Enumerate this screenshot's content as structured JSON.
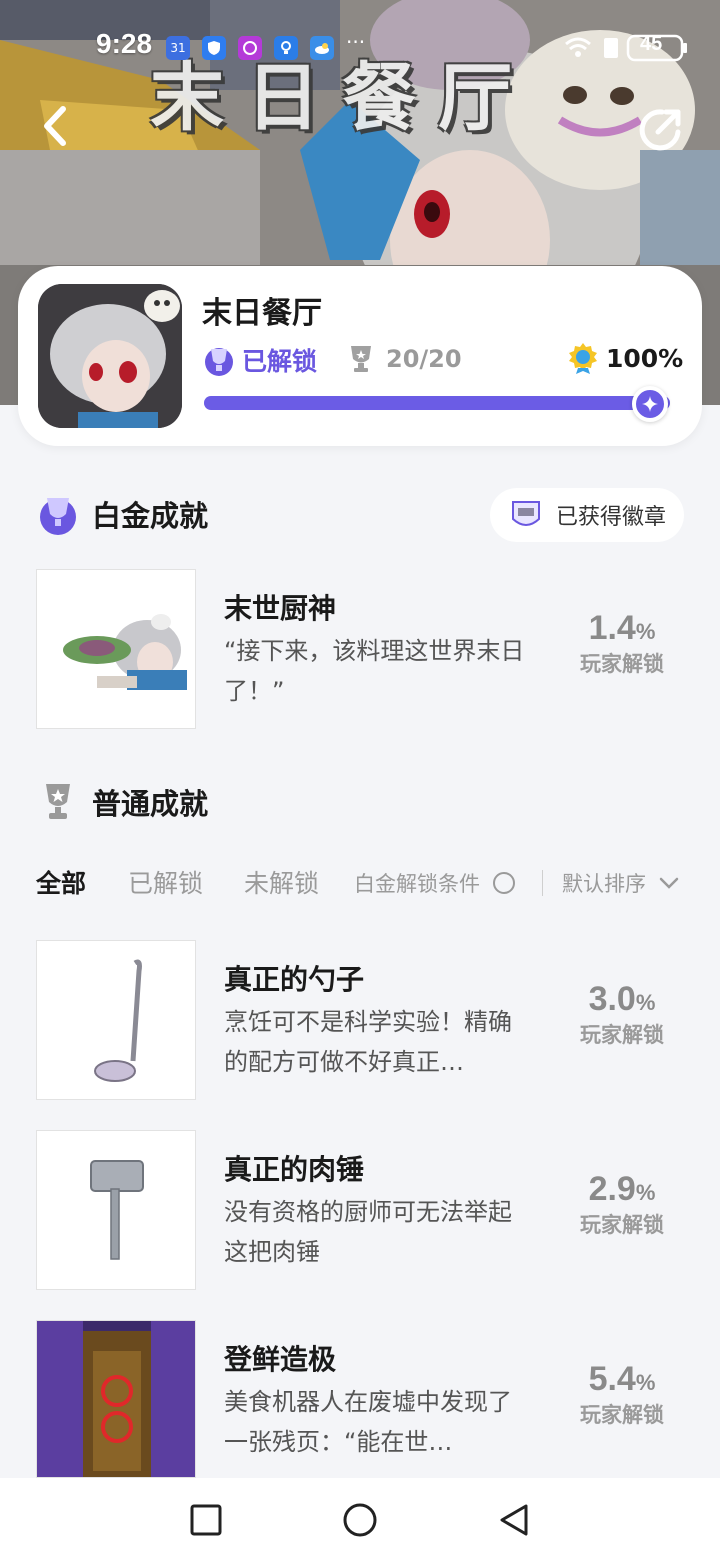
{
  "status_bar": {
    "time": "9:28",
    "calendar_badge": "31",
    "dots": "···",
    "battery": "45"
  },
  "banner": {
    "title": "末日餐厅"
  },
  "game": {
    "name": "末日餐厅",
    "unlock_label": "已解锁",
    "trophy_count": "20/20",
    "completion": "100%",
    "progress_fraction": 1.0
  },
  "platinum_section": {
    "title": "白金成就",
    "badge_chip_label": "已获得徽章",
    "achievement": {
      "name": "末世厨神",
      "desc": "“接下来，该料理这世界末日了！”",
      "pct_num": "1.4",
      "pct_unit": "%",
      "pct_label": "玩家解锁"
    }
  },
  "normal_section": {
    "title": "普通成就",
    "filters": {
      "all": "全部",
      "unlocked": "已解锁",
      "locked": "未解锁",
      "platinum_condition": "白金解锁条件",
      "sort": "默认排序"
    },
    "achievements": [
      {
        "name": "真正的勺子",
        "desc": "烹饪可不是科学实验！精确的配方可做不好真正…",
        "pct_num": "3.0",
        "pct_unit": "%",
        "pct_label": "玩家解锁"
      },
      {
        "name": "真正的肉锤",
        "desc": "没有资格的厨师可无法举起这把肉锤",
        "pct_num": "2.9",
        "pct_unit": "%",
        "pct_label": "玩家解锁"
      },
      {
        "name": "登鲜造极",
        "desc": "美食机器人在废墟中发现了一张残页：“能在世…",
        "pct_num": "5.4",
        "pct_unit": "%",
        "pct_label": "玩家解锁"
      }
    ]
  },
  "colors": {
    "accent": "#6b5ce5",
    "background": "#f4f5f8"
  }
}
